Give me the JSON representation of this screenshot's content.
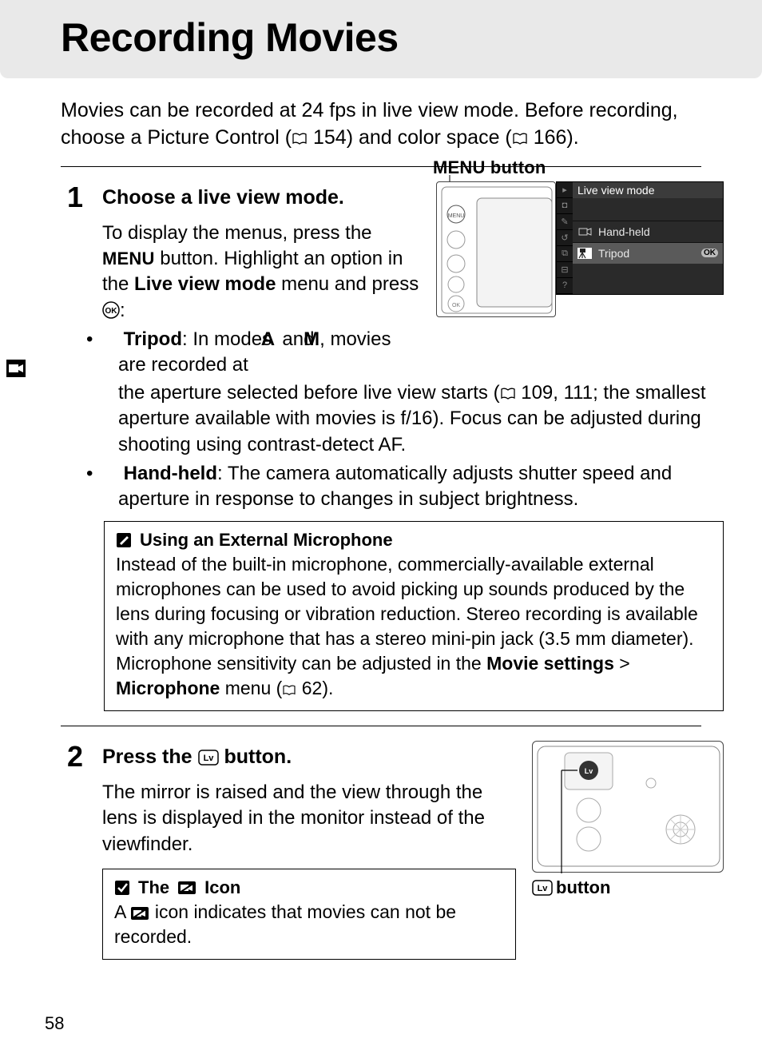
{
  "page_number": "58",
  "title": "Recording Movies",
  "intro_1": "Movies can be recorded at 24 fps in live view mode.  Before recording, choose a Picture Control (",
  "intro_ref1": "154",
  "intro_2": ") and color space (",
  "intro_ref2": "166",
  "intro_3": ").",
  "step1": {
    "number": "1",
    "heading": "Choose a live view mode.",
    "menu_button_label": "MENU button",
    "body_prefix": "To display the menus, press the ",
    "menu_word": "MENU",
    "body_mid": " button.  Highlight an option in the ",
    "live_view_mode": "Live view mode",
    "body_suffix": " menu and press ",
    "ok_label": "OK",
    "body_end": ":",
    "tripod_label": "Tripod",
    "tripod_part1": ": In modes ",
    "mode_a": "A",
    "tripod_and": " and ",
    "mode_m": "M",
    "tripod_part2": ", movies are recorded at the aperture selected before live view starts (",
    "tripod_ref": "109, 111",
    "tripod_part3": "; the smallest aperture available with movies is f/16).  Focus can be adjusted during shooting using contrast-detect AF.",
    "handheld_label": "Hand-held",
    "handheld_text": ": The camera automatically adjusts shutter speed and aperture in response to changes in subject brightness."
  },
  "menu_screen": {
    "title": "Live view mode",
    "hand_held": "Hand-held",
    "tripod": "Tripod",
    "ok": "OK"
  },
  "callout_mic": {
    "heading": "Using an External Microphone",
    "body_1": "Instead of the built-in microphone, commercially-available external microphones can be used to avoid picking up sounds produced by the lens during focusing or vibration reduction.  Stereo recording is available with any microphone that has a stereo mini-pin jack (3.5 mm diameter).  Microphone sensitivity can be adjusted in the ",
    "movie_settings": "Movie settings",
    "gt": " > ",
    "microphone": "Microphone",
    "body_2": " menu (",
    "ref": "62",
    "body_3": ")."
  },
  "step2": {
    "number": "2",
    "heading_prefix": "Press the ",
    "heading_suffix": " button.",
    "body": "The mirror is raised and the view through the lens is displayed in the monitor instead of the viewfinder.",
    "lv_button_label": "button"
  },
  "callout_icon": {
    "heading_prefix": "The ",
    "heading_suffix": " Icon",
    "body_prefix": "A ",
    "body_suffix": " icon indicates that movies can not be recorded."
  }
}
